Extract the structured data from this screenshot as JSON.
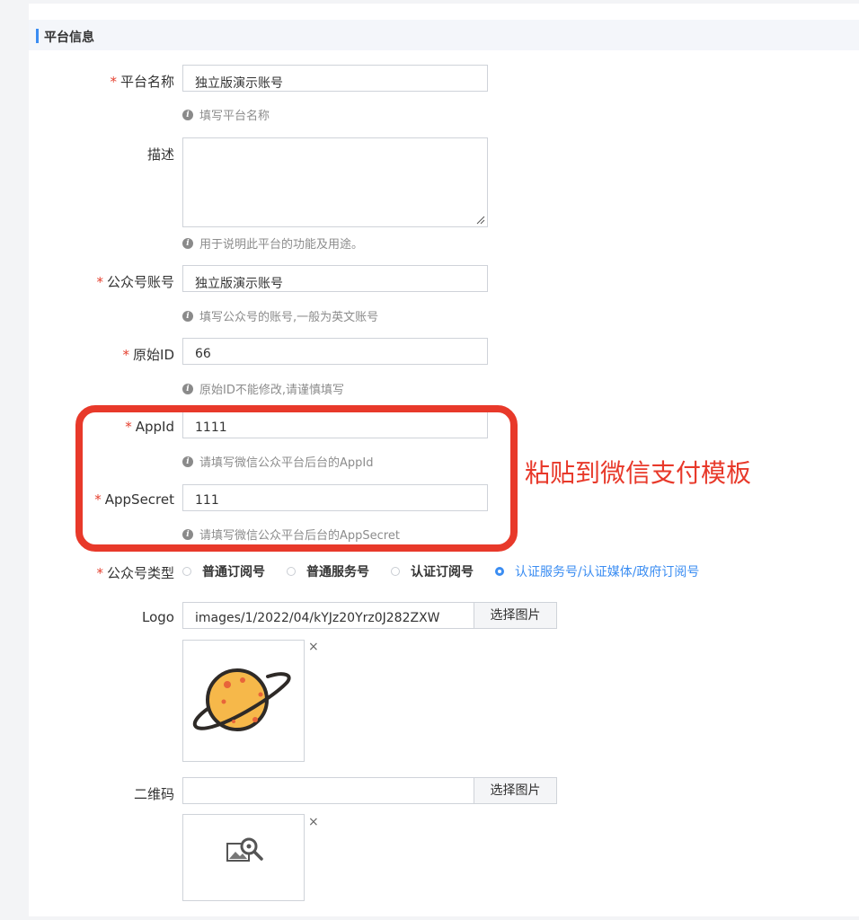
{
  "section": {
    "title": "平台信息"
  },
  "fields": {
    "platform_name": {
      "label": "平台名称",
      "value": "独立版演示账号",
      "hint": "填写平台名称"
    },
    "description": {
      "label": "描述",
      "value": "",
      "hint": "用于说明此平台的功能及用途。"
    },
    "account": {
      "label": "公众号账号",
      "value": "独立版演示账号",
      "hint": "填写公众号的账号,一般为英文账号"
    },
    "original_id": {
      "label": "原始ID",
      "value": "66",
      "hint": "原始ID不能修改,请谨慎填写"
    },
    "appid": {
      "label": "AppId",
      "value": "1111",
      "hint": "请填写微信公众平台后台的AppId"
    },
    "appsecret": {
      "label": "AppSecret",
      "value": "111",
      "hint": "请填写微信公众平台后台的AppSecret"
    },
    "account_type": {
      "label": "公众号类型",
      "options": [
        "普通订阅号",
        "普通服务号",
        "认证订阅号",
        "认证服务号/认证媒体/政府订阅号"
      ],
      "selected": "认证服务号/认证媒体/政府订阅号"
    },
    "logo": {
      "label": "Logo",
      "value": "images/1/2022/04/kYJz20Yrz0J282ZXW",
      "button": "选择图片"
    },
    "qrcode": {
      "label": "二维码",
      "value": "",
      "button": "选择图片"
    }
  },
  "required_mark": "*",
  "close_mark": "×",
  "annotation": {
    "text": "粘贴到微信支付模板",
    "color": "#e8392a"
  },
  "colors": {
    "accent": "#3b8df2",
    "required": "#e5402f",
    "annotation": "#e8392a"
  },
  "icons": {
    "hint": "info-icon",
    "logo_image": "planet-icon",
    "qrcode_placeholder": "image-search-icon"
  }
}
